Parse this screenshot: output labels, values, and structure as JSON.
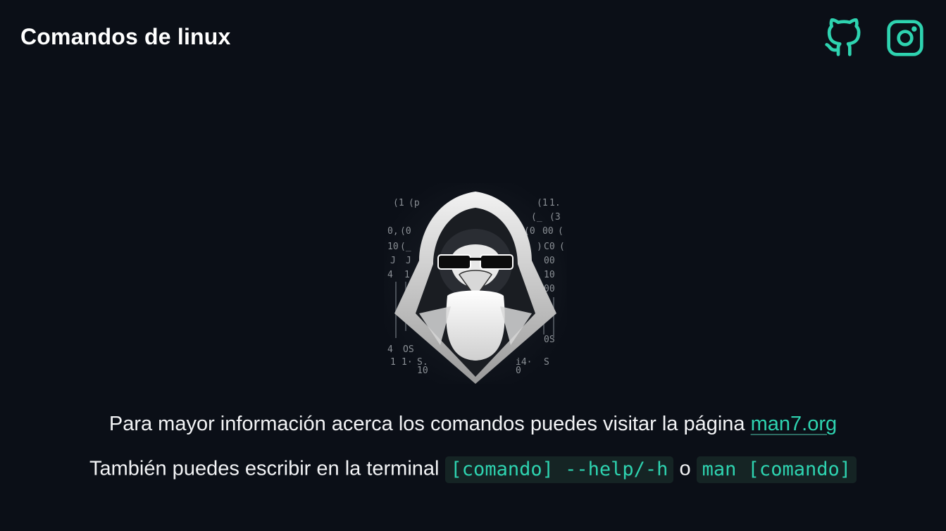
{
  "header": {
    "title": "Comandos de linux",
    "social": [
      {
        "name": "github-icon",
        "color": "#2ed3b0"
      },
      {
        "name": "instagram-icon",
        "color": "#2ed3b0"
      }
    ]
  },
  "hero": {
    "image": "hooded-penguin-with-sunglasses-icon",
    "background_glyphs": [
      "(1",
      "(p",
      "0,",
      "(_",
      "10",
      "J",
      "4",
      "(1",
      "(0",
      "00",
      "C0",
      "00",
      "10",
      "00",
      "OS",
      "0S",
      "S.",
      "10",
      "1.",
      "i3",
      "4.",
      "S"
    ]
  },
  "info": {
    "line1_text": "Para mayor información acerca los comandos puedes visitar la página ",
    "link_label": "man7.org",
    "line2_text": "También puedes escribir en la terminal ",
    "code_help": "[comando] --help/-h",
    "connector": " o ",
    "code_man": "man [comando]"
  },
  "colors": {
    "background": "#0b0f17",
    "accent": "#2ed3b0",
    "code_bg": "#152424"
  }
}
